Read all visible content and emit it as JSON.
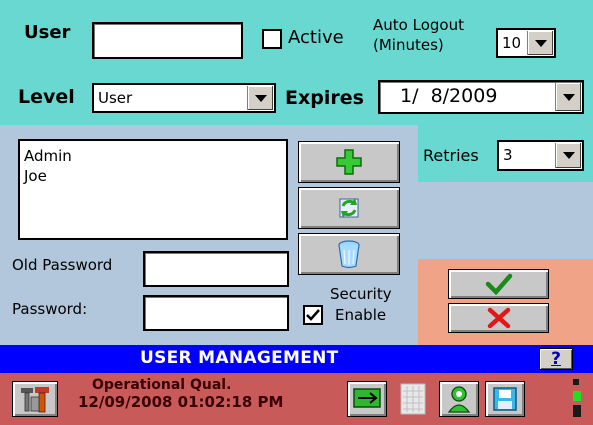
{
  "form": {
    "user_label": "User",
    "user_value": "",
    "active_label": "Active",
    "active_checked": false,
    "auto_logout_label_line1": "Auto Logout",
    "auto_logout_label_line2": "(Minutes)",
    "auto_logout_value": "10",
    "level_label": "Level",
    "level_value": "User",
    "expires_label": "Expires",
    "expires_value": "1/  8/2009",
    "retries_label": "Retries",
    "retries_value": "3"
  },
  "user_list": {
    "items": [
      "Admin",
      "Joe"
    ]
  },
  "passwords": {
    "old_password_label": "Old Password",
    "old_password_value": "",
    "password_label": "Password:",
    "password_value": ""
  },
  "security": {
    "label_line1": "Security",
    "label_line2": "Enable",
    "enabled": true
  },
  "title_bar": {
    "title": "USER MANAGEMENT",
    "help_label": "?"
  },
  "status_bar": {
    "line1": "Operational Qual.",
    "line2": "12/09/2008 01:02:18 PM"
  },
  "colors": {
    "teal": "#68d8d0",
    "blue_panel": "#b2c6dc",
    "salmon": "#f0a386",
    "title_bar": "#0000ff",
    "status_bar": "#c85a5a"
  },
  "icons": {
    "add": "plus-icon",
    "refresh": "refresh-icon",
    "delete": "trash-icon",
    "ok": "checkmark-icon",
    "cancel": "x-icon",
    "tools": "tools-icon",
    "network": "network-icon",
    "grid": "grid-icon",
    "person": "person-icon",
    "save": "save-icon",
    "status": "status-indicator-icon"
  }
}
